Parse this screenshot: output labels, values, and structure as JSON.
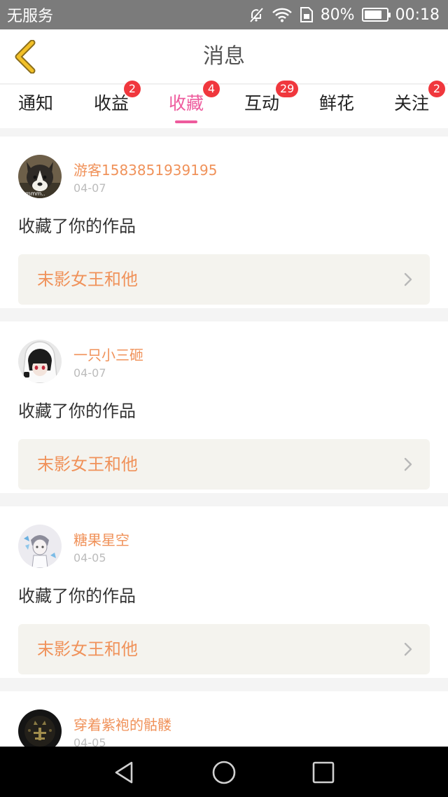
{
  "status_bar": {
    "carrier": "无服务",
    "battery": "80%",
    "battery_level": 0.8,
    "time": "00:18",
    "icons": [
      "mute-icon",
      "wifi-icon",
      "sim-icon",
      "battery-icon"
    ]
  },
  "header": {
    "title": "消息",
    "back_icon": "chevron-left-icon"
  },
  "tabs": [
    {
      "label": "通知",
      "badge": ""
    },
    {
      "label": "收益",
      "badge": "2"
    },
    {
      "label": "收藏",
      "badge": "4",
      "active": true
    },
    {
      "label": "互动",
      "badge": "29"
    },
    {
      "label": "鲜花",
      "badge": ""
    },
    {
      "label": "关注",
      "badge": "2"
    }
  ],
  "items": [
    {
      "user": "游客1583851939195",
      "date": "04-07",
      "action": "收藏了你的作品",
      "work": "末影女王和他",
      "avatar": "husky-dog"
    },
    {
      "user": "一只小三砸",
      "date": "04-07",
      "action": "收藏了你的作品",
      "work": "末影女王和他",
      "avatar": "anime-girl-hood"
    },
    {
      "user": "糖果星空",
      "date": "04-05",
      "action": "收藏了你的作品",
      "work": "末影女王和他",
      "avatar": "sketch-character"
    },
    {
      "user": "穿着紫袍的骷髅",
      "date": "04-05",
      "action": "",
      "work": "",
      "avatar": "dark-skull"
    }
  ],
  "colors": {
    "accent_pink": "#ee5b9d",
    "username_orange": "#f0925a",
    "badge_red": "#f0373d",
    "status_bar_gray": "#7b7b7b",
    "back_arrow_yellow": "#f2c027"
  },
  "system_nav": {
    "icons": [
      "back-triangle-icon",
      "home-circle-icon",
      "recents-square-icon"
    ]
  }
}
